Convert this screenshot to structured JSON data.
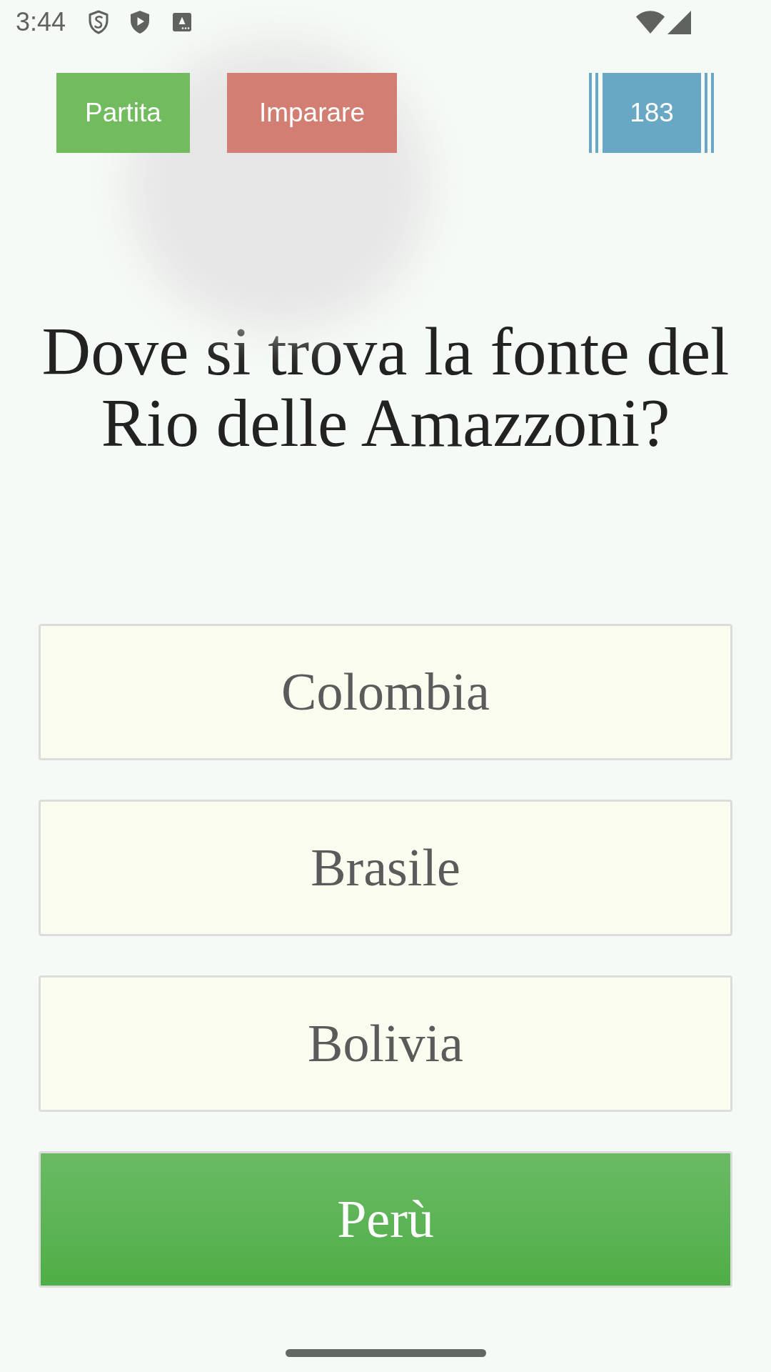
{
  "status_bar": {
    "time": "3:44"
  },
  "top_bar": {
    "buttons": [
      {
        "label": "Partita",
        "color": "#72bb5f"
      },
      {
        "label": "Imparare",
        "color": "#d27e73"
      }
    ],
    "score": "183"
  },
  "question": "Dove si trova la fonte del Rio delle Amazzoni?",
  "answers": [
    {
      "label": "Colombia",
      "selected": false
    },
    {
      "label": "Brasile",
      "selected": false
    },
    {
      "label": "Bolivia",
      "selected": false
    },
    {
      "label": "Perù",
      "selected": true
    }
  ]
}
